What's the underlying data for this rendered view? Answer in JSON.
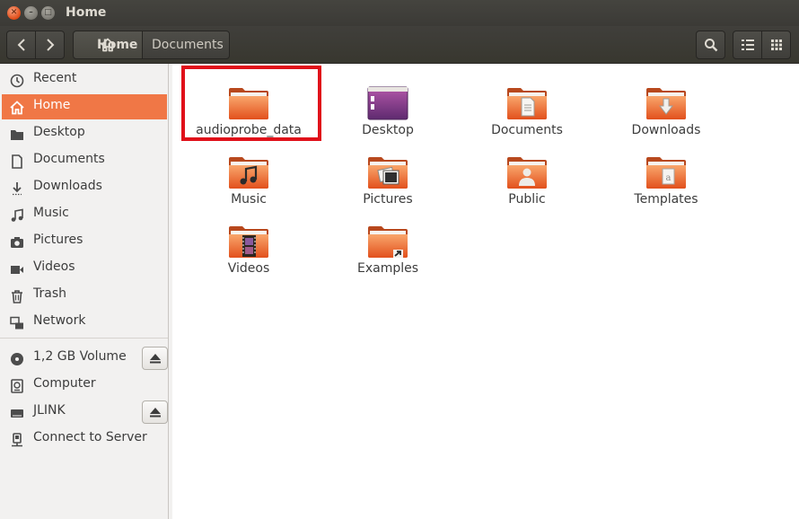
{
  "window": {
    "title": "Home",
    "controls": [
      "close",
      "minimize",
      "maximize"
    ]
  },
  "toolbar": {
    "breadcrumb": [
      {
        "label": "Home",
        "icon": "home-icon",
        "active": true
      },
      {
        "label": "Documents",
        "icon": null,
        "active": false
      }
    ]
  },
  "sidebar": {
    "places": [
      {
        "label": "Recent",
        "icon": "clock-icon",
        "active": false
      },
      {
        "label": "Home",
        "icon": "home-icon",
        "active": true
      },
      {
        "label": "Desktop",
        "icon": "folder-icon",
        "active": false
      },
      {
        "label": "Documents",
        "icon": "document-icon",
        "active": false
      },
      {
        "label": "Downloads",
        "icon": "download-icon",
        "active": false
      },
      {
        "label": "Music",
        "icon": "music-icon",
        "active": false
      },
      {
        "label": "Pictures",
        "icon": "camera-icon",
        "active": false
      },
      {
        "label": "Videos",
        "icon": "video-icon",
        "active": false
      },
      {
        "label": "Trash",
        "icon": "trash-icon",
        "active": false
      },
      {
        "label": "Network",
        "icon": "network-icon",
        "active": false
      }
    ],
    "devices": [
      {
        "label": "1,2 GB Volume",
        "icon": "disc-icon",
        "eject": true
      },
      {
        "label": "Computer",
        "icon": "computer-icon",
        "eject": false
      },
      {
        "label": "JLINK",
        "icon": "drive-icon",
        "eject": true
      },
      {
        "label": "Connect to Server",
        "icon": "server-icon",
        "eject": false
      }
    ]
  },
  "files": [
    {
      "label": "audioprobe_data",
      "type": "folder",
      "emblem": null,
      "highlighted": true
    },
    {
      "label": "Desktop",
      "type": "desktop",
      "emblem": null,
      "highlighted": false
    },
    {
      "label": "Documents",
      "type": "folder",
      "emblem": "document",
      "highlighted": false
    },
    {
      "label": "Downloads",
      "type": "folder",
      "emblem": "download",
      "highlighted": false
    },
    {
      "label": "Music",
      "type": "folder",
      "emblem": "music",
      "highlighted": false
    },
    {
      "label": "Pictures",
      "type": "folder",
      "emblem": "pictures",
      "highlighted": false
    },
    {
      "label": "Public",
      "type": "folder",
      "emblem": "public",
      "highlighted": false
    },
    {
      "label": "Templates",
      "type": "folder",
      "emblem": "templates",
      "highlighted": false
    },
    {
      "label": "Videos",
      "type": "folder",
      "emblem": "video",
      "highlighted": false
    },
    {
      "label": "Examples",
      "type": "folder",
      "emblem": "link",
      "highlighted": false
    }
  ],
  "colors": {
    "accent": "#f07746",
    "titlebar": "#3c3b37",
    "highlight_box": "#e0101a",
    "folder_orange": "#e9581f"
  }
}
